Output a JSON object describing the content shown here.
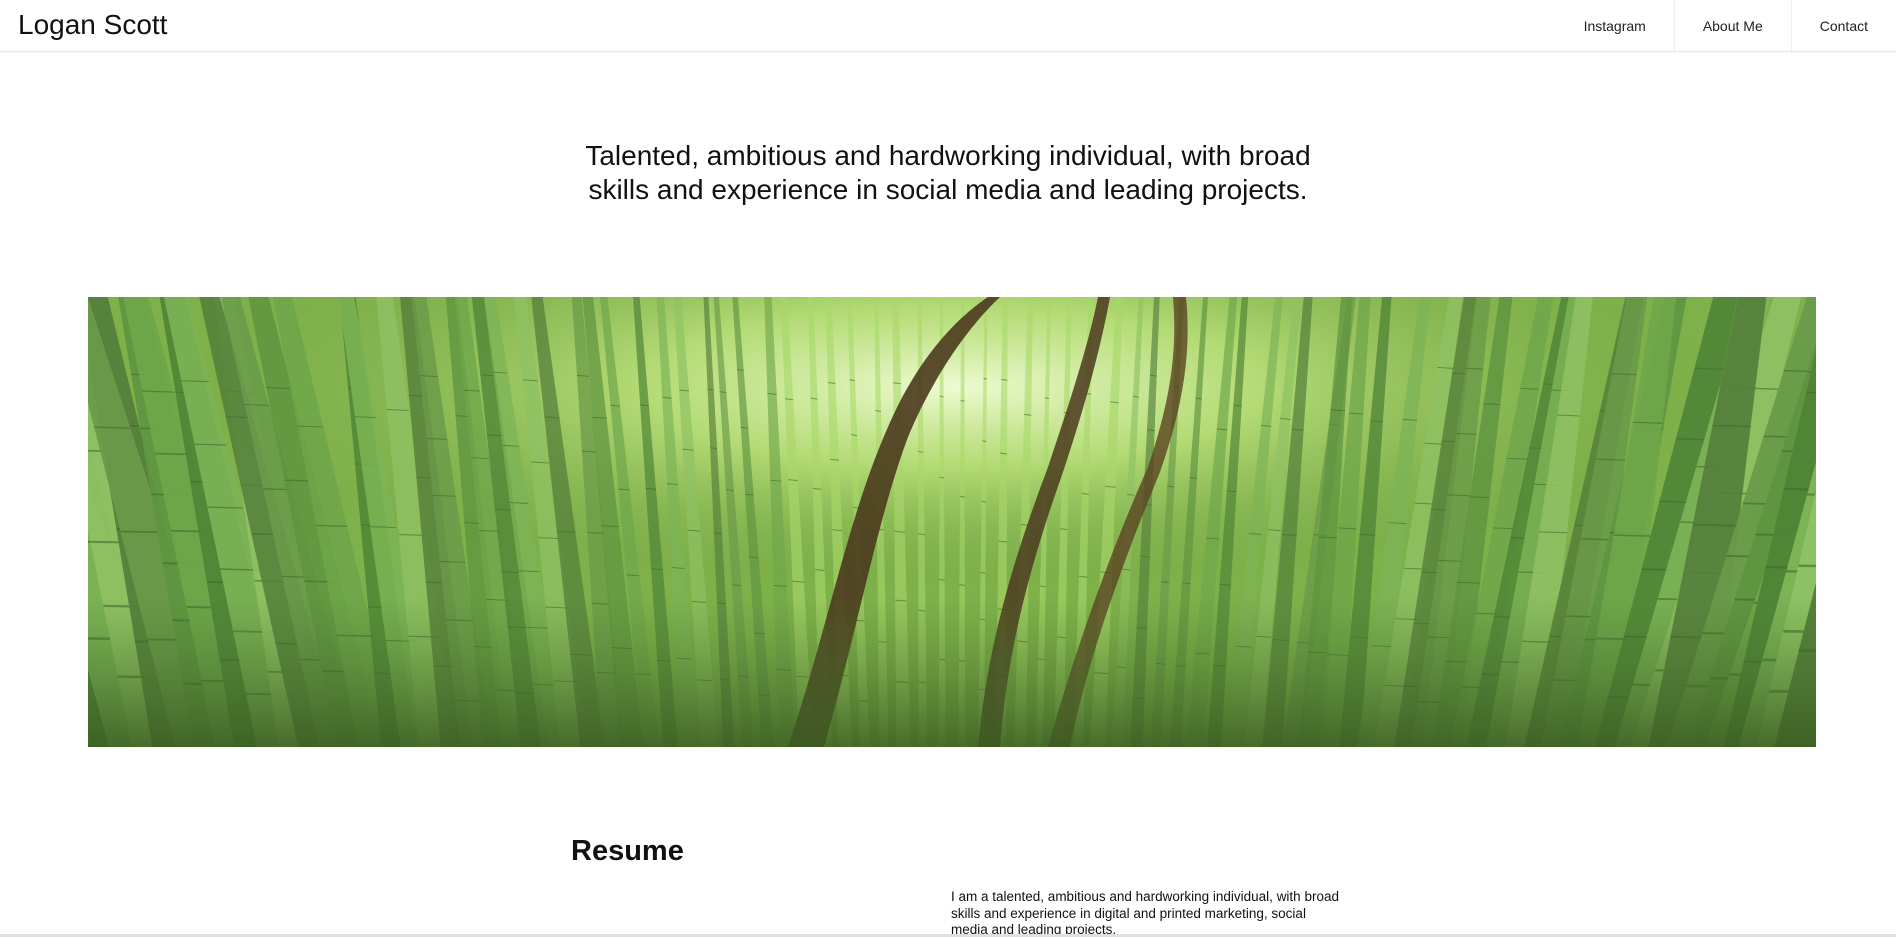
{
  "header": {
    "brand": "Logan Scott",
    "nav": [
      {
        "label": "Instagram"
      },
      {
        "label": "About Me"
      },
      {
        "label": "Contact"
      }
    ]
  },
  "hero": {
    "tagline_line1": "Talented, ambitious and hardworking individual, with broad",
    "tagline_line2": "skills and experience in social media and leading projects.",
    "image": "bamboo-forest-photo"
  },
  "resume": {
    "title": "Resume",
    "intro": "I am a talented, ambitious and hardworking individual, with broad skills and experience in digital and printed marketing, social media and leading projects."
  },
  "colors": {
    "text": "#111111",
    "background": "#ffffff",
    "divider": "#e6e6e6",
    "bamboo_light": "#a8d86a",
    "bamboo_dark": "#3f6a2d"
  }
}
